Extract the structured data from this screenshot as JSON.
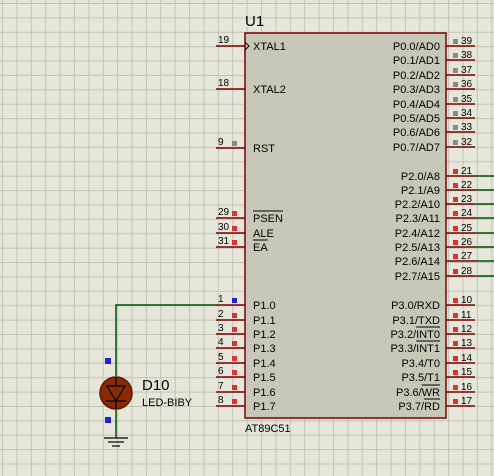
{
  "chip": {
    "ref": "U1",
    "part": "AT89C51",
    "left_pins": [
      {
        "num": "19",
        "name": "XTAL1"
      },
      {
        "num": "18",
        "name": "XTAL2"
      },
      {
        "num": "9",
        "name": "RST"
      },
      {
        "num": "29",
        "name": "PSEN"
      },
      {
        "num": "30",
        "name": "ALE"
      },
      {
        "num": "31",
        "name": "EA"
      },
      {
        "num": "1",
        "name": "P1.0"
      },
      {
        "num": "2",
        "name": "P1.1"
      },
      {
        "num": "3",
        "name": "P1.2"
      },
      {
        "num": "4",
        "name": "P1.3"
      },
      {
        "num": "5",
        "name": "P1.4"
      },
      {
        "num": "6",
        "name": "P1.5"
      },
      {
        "num": "7",
        "name": "P1.6"
      },
      {
        "num": "8",
        "name": "P1.7"
      }
    ],
    "right_pins": [
      {
        "num": "39",
        "name": "P0.0/AD0"
      },
      {
        "num": "38",
        "name": "P0.1/AD1"
      },
      {
        "num": "37",
        "name": "P0.2/AD2"
      },
      {
        "num": "36",
        "name": "P0.3/AD3"
      },
      {
        "num": "35",
        "name": "P0.4/AD4"
      },
      {
        "num": "34",
        "name": "P0.5/AD5"
      },
      {
        "num": "33",
        "name": "P0.6/AD6"
      },
      {
        "num": "32",
        "name": "P0.7/AD7"
      },
      {
        "num": "21",
        "name": "P2.0/A8"
      },
      {
        "num": "22",
        "name": "P2.1/A9"
      },
      {
        "num": "23",
        "name": "P2.2/A10"
      },
      {
        "num": "24",
        "name": "P2.3/A11"
      },
      {
        "num": "25",
        "name": "P2.4/A12"
      },
      {
        "num": "26",
        "name": "P2.5/A13"
      },
      {
        "num": "27",
        "name": "P2.6/A14"
      },
      {
        "num": "28",
        "name": "P2.7/A15"
      },
      {
        "num": "10",
        "name": "P3.0/RXD"
      },
      {
        "num": "11",
        "name": "P3.1/TXD"
      },
      {
        "num": "12",
        "name": "P3.2/INT0"
      },
      {
        "num": "13",
        "name": "P3.3/INT1"
      },
      {
        "num": "14",
        "name": "P3.4/T0"
      },
      {
        "num": "15",
        "name": "P3.5/T1"
      },
      {
        "num": "16",
        "name": "P3.6/WR"
      },
      {
        "num": "17",
        "name": "P3.7/RD"
      }
    ]
  },
  "led": {
    "ref": "D10",
    "part": "LED-BIBY"
  },
  "colors": {
    "background": "#e6e6da",
    "chip_body": "#c8c8b8",
    "outline": "#7a0000",
    "wire": "#005000",
    "pin_marker_red": "#e03030",
    "pin_marker_gray": "#8a8a8a",
    "pin_marker_blue": "#2020e0",
    "led_fill": "#8a2a00"
  },
  "icons": {
    "led": "led-diode-icon",
    "ground": "ground-icon"
  }
}
